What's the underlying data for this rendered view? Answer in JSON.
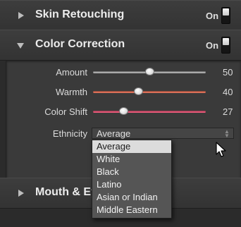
{
  "sections": {
    "skin_retouching": {
      "title": "Skin Retouching",
      "state": "On"
    },
    "color_correction": {
      "title": "Color Correction",
      "state": "On"
    },
    "mouth_eyes": {
      "title": "Mouth & Ey"
    }
  },
  "sliders": {
    "amount": {
      "label": "Amount",
      "value": "50",
      "level": 0.5,
      "color": "#b0b0b0"
    },
    "warmth": {
      "label": "Warmth",
      "value": "40",
      "level": 0.4,
      "color": "#e0725a"
    },
    "color_shift": {
      "label": "Color Shift",
      "value": "27",
      "level": 0.27,
      "color": "#e85a7a"
    }
  },
  "ethnicity": {
    "label": "Ethnicity",
    "selected": "Average",
    "options": [
      "Average",
      "White",
      "Black",
      "Latino",
      "Asian or Indian",
      "Middle Eastern"
    ]
  },
  "icons": {
    "collapsed": "triangle-right-icon",
    "expanded": "triangle-down-icon",
    "cursor": "arrow-cursor-icon"
  }
}
